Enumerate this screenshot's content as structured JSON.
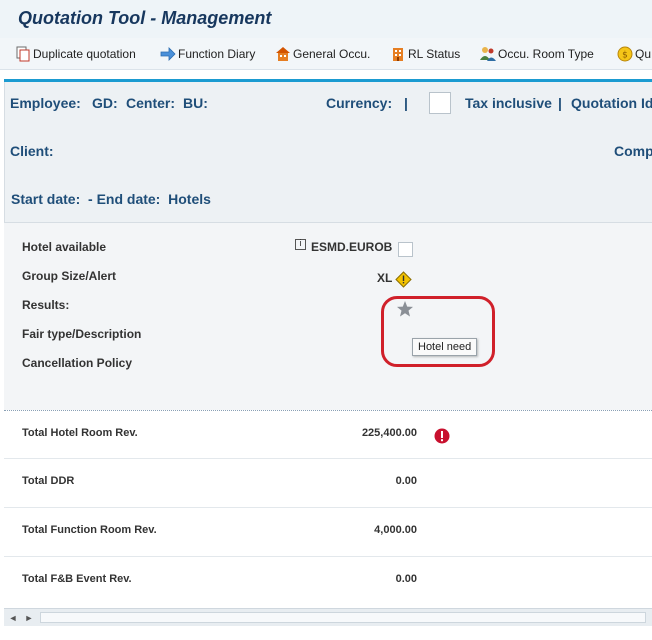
{
  "window": {
    "title": "Quotation Tool - Management"
  },
  "toolbar": {
    "items": [
      {
        "label": "Duplicate quotation",
        "icon": "duplicate-icon"
      },
      {
        "label": "Function Diary",
        "icon": "arrow-right-icon"
      },
      {
        "label": "General Occu.",
        "icon": "building-icon"
      },
      {
        "label": "RL Status",
        "icon": "hotel-icon"
      },
      {
        "label": "Occu. Room Type",
        "icon": "people-icon"
      },
      {
        "label": "Qu",
        "icon": "coin-icon"
      }
    ]
  },
  "header": {
    "employee": "Employee:",
    "gd": "GD:",
    "center": "Center:",
    "bu": "BU:",
    "currency": "Currency:",
    "sep1": "|",
    "tax_inclusive": "Tax inclusive",
    "sep2": "|",
    "quotation_id": "Quotation Id",
    "client": "Client:",
    "comp": "Comp",
    "dates": "Start date:  - End date:  Hotels"
  },
  "fields": {
    "hotel_available": {
      "label": "Hotel available",
      "value": "ESMD.EUROB"
    },
    "group_size": {
      "label": "Group Size/Alert",
      "value": "XL"
    },
    "results": {
      "label": "Results:"
    },
    "fair_type": {
      "label": "Fair type/Description"
    },
    "cancellation": {
      "label": "Cancellation Policy"
    }
  },
  "tooltip": {
    "text": "Hotel need"
  },
  "totals": [
    {
      "label": "Total Hotel Room Rev.",
      "value": "225,400.00",
      "alert": true
    },
    {
      "label": "Total DDR",
      "value": "0.00"
    },
    {
      "label": "Total Function Room Rev.",
      "value": "4,000.00"
    },
    {
      "label": "Total F&B Event Rev.",
      "value": "0.00"
    }
  ],
  "colors": {
    "accent": "#1b9bd1",
    "label_blue": "#1f4e79",
    "highlight": "#d0202a",
    "error": "#c8102e",
    "warning": "#f2c200"
  }
}
